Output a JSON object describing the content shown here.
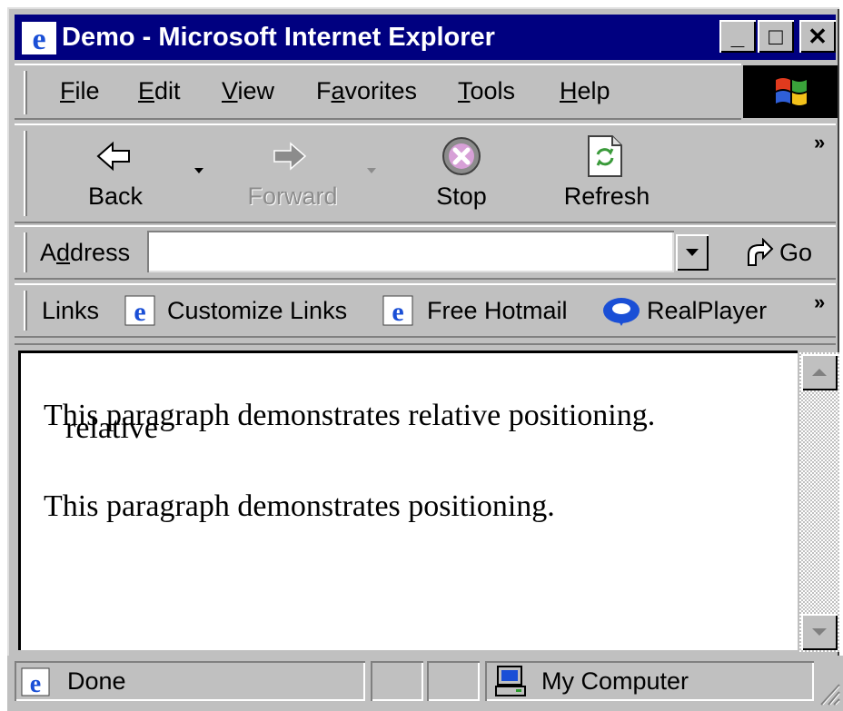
{
  "window": {
    "title": "Demo - Microsoft Internet Explorer"
  },
  "titlebar_controls": {
    "minimize": "_",
    "maximize": "□",
    "close": "✕"
  },
  "menu": {
    "items": [
      {
        "pre": "",
        "key": "F",
        "post": "ile"
      },
      {
        "pre": "",
        "key": "E",
        "post": "dit"
      },
      {
        "pre": "",
        "key": "V",
        "post": "iew"
      },
      {
        "pre": "F",
        "key": "a",
        "post": "vorites"
      },
      {
        "pre": "",
        "key": "T",
        "post": "ools"
      },
      {
        "pre": "",
        "key": "H",
        "post": "elp"
      }
    ]
  },
  "toolbar": {
    "back": "Back",
    "forward": "Forward",
    "stop": "Stop",
    "refresh": "Refresh",
    "overflow": "»"
  },
  "address": {
    "label_pre": "A",
    "label_key": "d",
    "label_post": "dress",
    "value": "",
    "go": "Go"
  },
  "links": {
    "label": "Links",
    "items": [
      "Customize Links",
      "Free Hotmail",
      "RealPlayer"
    ],
    "overflow": "»"
  },
  "content": {
    "para1": "This paragraph demonstrates relative positioning.",
    "para1_overlap": "relative",
    "para2": "This paragraph demonstrates positioning."
  },
  "status": {
    "text": "Done",
    "zone": "My Computer"
  }
}
